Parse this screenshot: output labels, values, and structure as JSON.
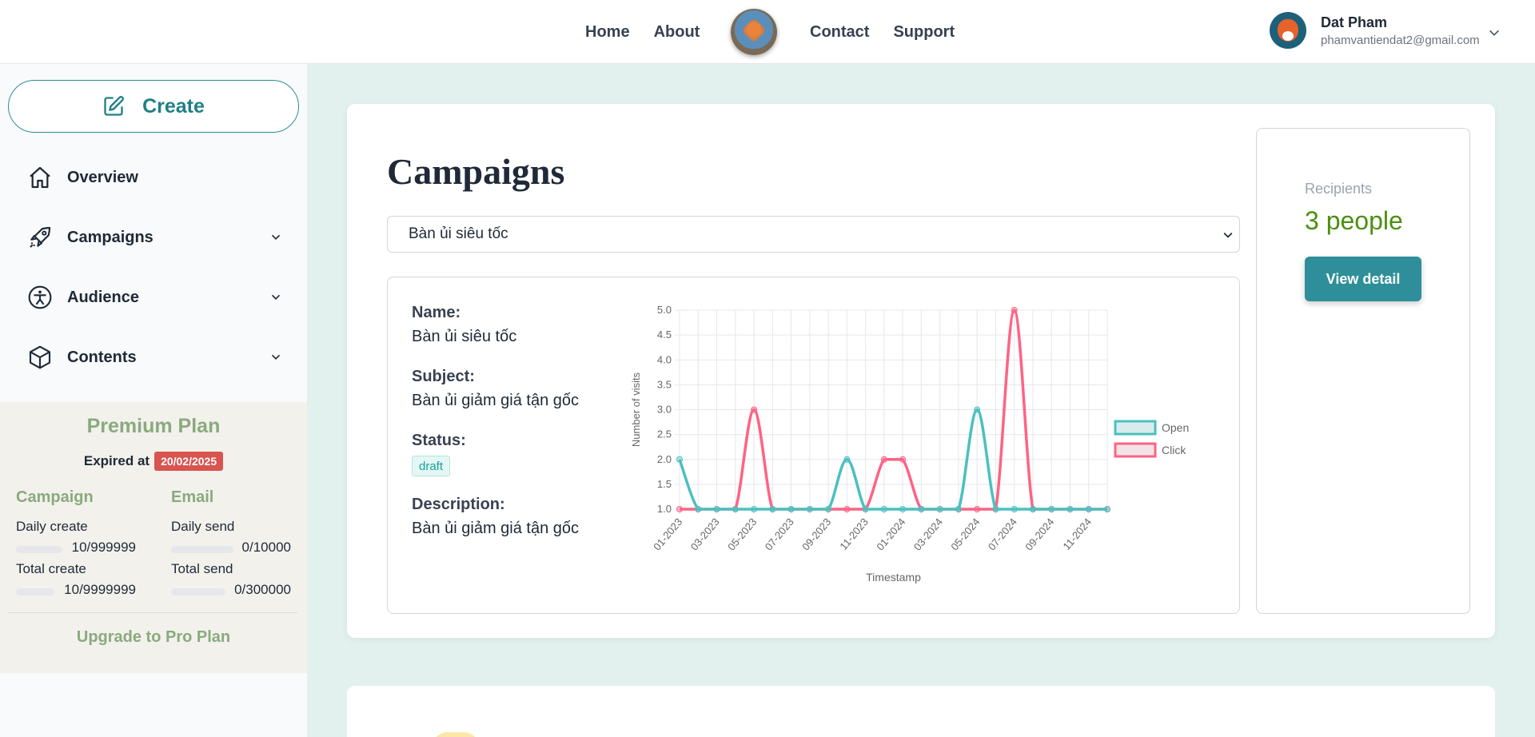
{
  "header": {
    "nav": [
      "Home",
      "About",
      "Contact",
      "Support"
    ],
    "user": {
      "name": "Dat Pham",
      "email": "phamvantiendat2@gmail.com"
    }
  },
  "sidebar": {
    "create_label": "Create",
    "items": [
      {
        "label": "Overview",
        "icon": "home-icon"
      },
      {
        "label": "Campaigns",
        "icon": "rocket-icon"
      },
      {
        "label": "Audience",
        "icon": "accessibility-icon"
      },
      {
        "label": "Contents",
        "icon": "box-icon"
      }
    ],
    "plan": {
      "title": "Premium Plan",
      "expired_label": "Expired at",
      "expired_date": "20/02/2025",
      "campaign": {
        "title": "Campaign",
        "daily_label": "Daily create",
        "daily_value": "10/999999",
        "total_label": "Total create",
        "total_value": "10/9999999"
      },
      "email": {
        "title": "Email",
        "daily_label": "Daily send",
        "daily_value": "0/10000",
        "total_label": "Total send",
        "total_value": "0/300000"
      },
      "upgrade_label": "Upgrade to Pro Plan"
    }
  },
  "main": {
    "title": "Campaigns",
    "selected_campaign": "Bàn ủi siêu tốc",
    "details": {
      "name_label": "Name:",
      "name_value": "Bàn ủi siêu tốc",
      "subject_label": "Subject:",
      "subject_value": "Bàn ủi giảm giá tận gốc",
      "status_label": "Status:",
      "status_value": "draft",
      "description_label": "Description:",
      "description_value": "Bàn ủi giảm giá tận gốc"
    },
    "recipients": {
      "label": "Recipients",
      "value": "3 people",
      "button": "View detail"
    }
  },
  "colors": {
    "accent": "#2e8f9a",
    "open": "#4bc0c0",
    "click": "#ff6384",
    "plan": "#8aaa7d",
    "badge": "#d9534f"
  },
  "chart_data": {
    "type": "line",
    "xlabel": "Timestamp",
    "ylabel": "Number of visits",
    "ylim": [
      1.0,
      5.0
    ],
    "yticks": [
      "1.0",
      "1.5",
      "2.0",
      "2.5",
      "3.0",
      "3.5",
      "4.0",
      "4.5",
      "5.0"
    ],
    "categories": [
      "01-2023",
      "02-2023",
      "03-2023",
      "04-2023",
      "05-2023",
      "06-2023",
      "07-2023",
      "08-2023",
      "09-2023",
      "10-2023",
      "11-2023",
      "12-2023",
      "01-2024",
      "02-2024",
      "03-2024",
      "04-2024",
      "05-2024",
      "06-2024",
      "07-2024",
      "08-2024",
      "09-2024",
      "10-2024",
      "11-2024",
      "12-2024"
    ],
    "tick_labels": [
      "01-2023",
      "03-2023",
      "05-2023",
      "07-2023",
      "09-2023",
      "11-2023",
      "01-2024",
      "03-2024",
      "05-2024",
      "07-2024",
      "09-2024",
      "11-2024"
    ],
    "legend_position": "right",
    "series": [
      {
        "name": "Open",
        "color": "#4bc0c0",
        "values": [
          2,
          1,
          1,
          1,
          1,
          1,
          1,
          1,
          1,
          2,
          1,
          1,
          1,
          1,
          1,
          1,
          3,
          1,
          1,
          1,
          1,
          1,
          1,
          1
        ]
      },
      {
        "name": "Click",
        "color": "#ff6384",
        "values": [
          1,
          1,
          1,
          1,
          3,
          1,
          1,
          1,
          1,
          1,
          1,
          2,
          2,
          1,
          1,
          1,
          1,
          1,
          5,
          1,
          1,
          1,
          1,
          1
        ]
      }
    ]
  }
}
